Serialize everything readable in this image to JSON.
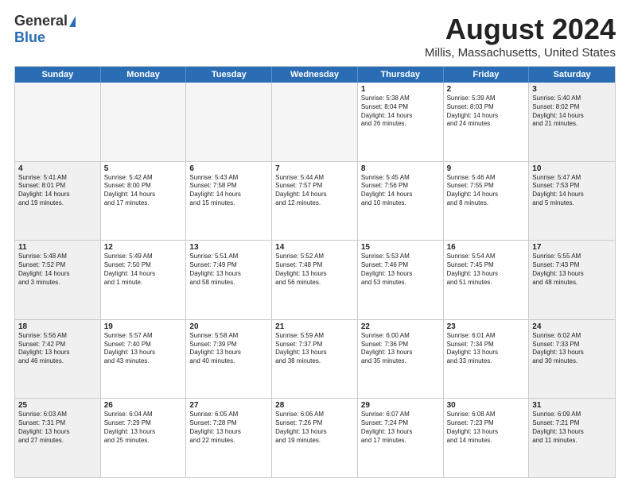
{
  "logo": {
    "general": "General",
    "blue": "Blue"
  },
  "title": "August 2024",
  "subtitle": "Millis, Massachusetts, United States",
  "header_days": [
    "Sunday",
    "Monday",
    "Tuesday",
    "Wednesday",
    "Thursday",
    "Friday",
    "Saturday"
  ],
  "weeks": [
    [
      {
        "day": "",
        "empty": true
      },
      {
        "day": "",
        "empty": true
      },
      {
        "day": "",
        "empty": true
      },
      {
        "day": "",
        "empty": true
      },
      {
        "day": "1",
        "line1": "Sunrise: 5:38 AM",
        "line2": "Sunset: 8:04 PM",
        "line3": "Daylight: 14 hours",
        "line4": "and 26 minutes."
      },
      {
        "day": "2",
        "line1": "Sunrise: 5:39 AM",
        "line2": "Sunset: 8:03 PM",
        "line3": "Daylight: 14 hours",
        "line4": "and 24 minutes."
      },
      {
        "day": "3",
        "shade": true,
        "line1": "Sunrise: 5:40 AM",
        "line2": "Sunset: 8:02 PM",
        "line3": "Daylight: 14 hours",
        "line4": "and 21 minutes."
      }
    ],
    [
      {
        "day": "4",
        "shade": true,
        "line1": "Sunrise: 5:41 AM",
        "line2": "Sunset: 8:01 PM",
        "line3": "Daylight: 14 hours",
        "line4": "and 19 minutes."
      },
      {
        "day": "5",
        "line1": "Sunrise: 5:42 AM",
        "line2": "Sunset: 8:00 PM",
        "line3": "Daylight: 14 hours",
        "line4": "and 17 minutes."
      },
      {
        "day": "6",
        "line1": "Sunrise: 5:43 AM",
        "line2": "Sunset: 7:58 PM",
        "line3": "Daylight: 14 hours",
        "line4": "and 15 minutes."
      },
      {
        "day": "7",
        "line1": "Sunrise: 5:44 AM",
        "line2": "Sunset: 7:57 PM",
        "line3": "Daylight: 14 hours",
        "line4": "and 12 minutes."
      },
      {
        "day": "8",
        "line1": "Sunrise: 5:45 AM",
        "line2": "Sunset: 7:56 PM",
        "line3": "Daylight: 14 hours",
        "line4": "and 10 minutes."
      },
      {
        "day": "9",
        "line1": "Sunrise: 5:46 AM",
        "line2": "Sunset: 7:55 PM",
        "line3": "Daylight: 14 hours",
        "line4": "and 8 minutes."
      },
      {
        "day": "10",
        "shade": true,
        "line1": "Sunrise: 5:47 AM",
        "line2": "Sunset: 7:53 PM",
        "line3": "Daylight: 14 hours",
        "line4": "and 5 minutes."
      }
    ],
    [
      {
        "day": "11",
        "shade": true,
        "line1": "Sunrise: 5:48 AM",
        "line2": "Sunset: 7:52 PM",
        "line3": "Daylight: 14 hours",
        "line4": "and 3 minutes."
      },
      {
        "day": "12",
        "line1": "Sunrise: 5:49 AM",
        "line2": "Sunset: 7:50 PM",
        "line3": "Daylight: 14 hours",
        "line4": "and 1 minute."
      },
      {
        "day": "13",
        "line1": "Sunrise: 5:51 AM",
        "line2": "Sunset: 7:49 PM",
        "line3": "Daylight: 13 hours",
        "line4": "and 58 minutes."
      },
      {
        "day": "14",
        "line1": "Sunrise: 5:52 AM",
        "line2": "Sunset: 7:48 PM",
        "line3": "Daylight: 13 hours",
        "line4": "and 56 minutes."
      },
      {
        "day": "15",
        "line1": "Sunrise: 5:53 AM",
        "line2": "Sunset: 7:46 PM",
        "line3": "Daylight: 13 hours",
        "line4": "and 53 minutes."
      },
      {
        "day": "16",
        "line1": "Sunrise: 5:54 AM",
        "line2": "Sunset: 7:45 PM",
        "line3": "Daylight: 13 hours",
        "line4": "and 51 minutes."
      },
      {
        "day": "17",
        "shade": true,
        "line1": "Sunrise: 5:55 AM",
        "line2": "Sunset: 7:43 PM",
        "line3": "Daylight: 13 hours",
        "line4": "and 48 minutes."
      }
    ],
    [
      {
        "day": "18",
        "shade": true,
        "line1": "Sunrise: 5:56 AM",
        "line2": "Sunset: 7:42 PM",
        "line3": "Daylight: 13 hours",
        "line4": "and 46 minutes."
      },
      {
        "day": "19",
        "line1": "Sunrise: 5:57 AM",
        "line2": "Sunset: 7:40 PM",
        "line3": "Daylight: 13 hours",
        "line4": "and 43 minutes."
      },
      {
        "day": "20",
        "line1": "Sunrise: 5:58 AM",
        "line2": "Sunset: 7:39 PM",
        "line3": "Daylight: 13 hours",
        "line4": "and 40 minutes."
      },
      {
        "day": "21",
        "line1": "Sunrise: 5:59 AM",
        "line2": "Sunset: 7:37 PM",
        "line3": "Daylight: 13 hours",
        "line4": "and 38 minutes."
      },
      {
        "day": "22",
        "line1": "Sunrise: 6:00 AM",
        "line2": "Sunset: 7:36 PM",
        "line3": "Daylight: 13 hours",
        "line4": "and 35 minutes."
      },
      {
        "day": "23",
        "line1": "Sunrise: 6:01 AM",
        "line2": "Sunset: 7:34 PM",
        "line3": "Daylight: 13 hours",
        "line4": "and 33 minutes."
      },
      {
        "day": "24",
        "shade": true,
        "line1": "Sunrise: 6:02 AM",
        "line2": "Sunset: 7:33 PM",
        "line3": "Daylight: 13 hours",
        "line4": "and 30 minutes."
      }
    ],
    [
      {
        "day": "25",
        "shade": true,
        "line1": "Sunrise: 6:03 AM",
        "line2": "Sunset: 7:31 PM",
        "line3": "Daylight: 13 hours",
        "line4": "and 27 minutes."
      },
      {
        "day": "26",
        "line1": "Sunrise: 6:04 AM",
        "line2": "Sunset: 7:29 PM",
        "line3": "Daylight: 13 hours",
        "line4": "and 25 minutes."
      },
      {
        "day": "27",
        "line1": "Sunrise: 6:05 AM",
        "line2": "Sunset: 7:28 PM",
        "line3": "Daylight: 13 hours",
        "line4": "and 22 minutes."
      },
      {
        "day": "28",
        "line1": "Sunrise: 6:06 AM",
        "line2": "Sunset: 7:26 PM",
        "line3": "Daylight: 13 hours",
        "line4": "and 19 minutes."
      },
      {
        "day": "29",
        "line1": "Sunrise: 6:07 AM",
        "line2": "Sunset: 7:24 PM",
        "line3": "Daylight: 13 hours",
        "line4": "and 17 minutes."
      },
      {
        "day": "30",
        "line1": "Sunrise: 6:08 AM",
        "line2": "Sunset: 7:23 PM",
        "line3": "Daylight: 13 hours",
        "line4": "and 14 minutes."
      },
      {
        "day": "31",
        "shade": true,
        "line1": "Sunrise: 6:09 AM",
        "line2": "Sunset: 7:21 PM",
        "line3": "Daylight: 13 hours",
        "line4": "and 11 minutes."
      }
    ]
  ]
}
